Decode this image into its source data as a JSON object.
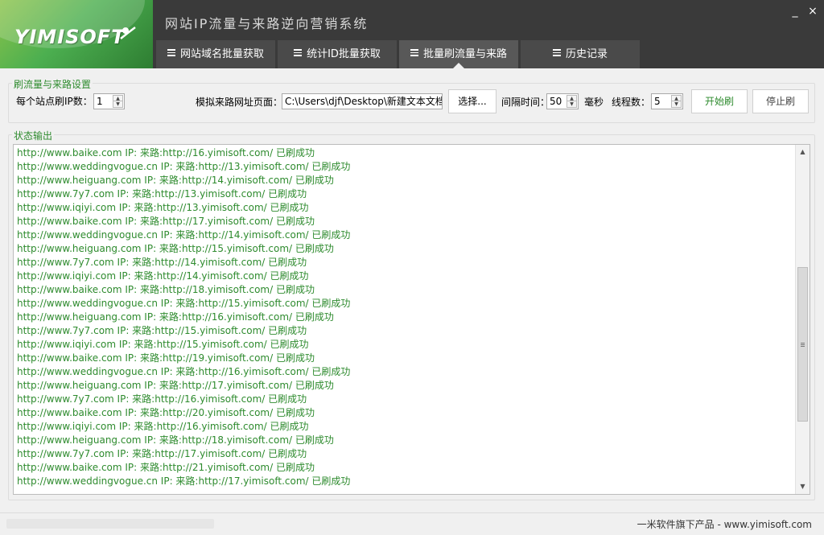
{
  "header": {
    "logo_text": "YIMISOFT",
    "title": "网站IP流量与来路逆向营销系统",
    "minimize_label": "_",
    "close_label": "×"
  },
  "tabs": [
    {
      "label": "网站域名批量获取"
    },
    {
      "label": "统计ID批量获取"
    },
    {
      "label": "批量刷流量与来路"
    },
    {
      "label": "历史记录"
    }
  ],
  "settings": {
    "group_title": "刷流量与来路设置",
    "per_site_label": "每个站点刷IP数：",
    "per_site_value": "1",
    "referer_label": "模拟来路网址页面：",
    "referer_path": "C:\\Users\\djf\\Desktop\\新建文本文档.txt",
    "choose_label": "选择...",
    "interval_label": "间隔时间：",
    "interval_value": "50",
    "interval_unit": "毫秒",
    "threads_label": "线程数：",
    "threads_value": "5",
    "start_label": "开始刷",
    "stop_label": "停止刷"
  },
  "status": {
    "group_title": "状态输出",
    "lines": [
      "http://www.baike.com IP: 来路:http://16.yimisoft.com/ 已刷成功",
      "http://www.weddingvogue.cn IP: 来路:http://13.yimisoft.com/ 已刷成功",
      "http://www.heiguang.com IP: 来路:http://14.yimisoft.com/ 已刷成功",
      "http://www.7y7.com IP: 来路:http://13.yimisoft.com/ 已刷成功",
      "http://www.iqiyi.com IP: 来路:http://13.yimisoft.com/ 已刷成功",
      "http://www.baike.com IP: 来路:http://17.yimisoft.com/ 已刷成功",
      "http://www.weddingvogue.cn IP: 来路:http://14.yimisoft.com/ 已刷成功",
      "http://www.heiguang.com IP: 来路:http://15.yimisoft.com/ 已刷成功",
      "http://www.7y7.com IP: 来路:http://14.yimisoft.com/ 已刷成功",
      "http://www.iqiyi.com IP: 来路:http://14.yimisoft.com/ 已刷成功",
      "http://www.baike.com IP: 来路:http://18.yimisoft.com/ 已刷成功",
      "http://www.weddingvogue.cn IP: 来路:http://15.yimisoft.com/ 已刷成功",
      "http://www.heiguang.com IP: 来路:http://16.yimisoft.com/ 已刷成功",
      "http://www.7y7.com IP: 来路:http://15.yimisoft.com/ 已刷成功",
      "http://www.iqiyi.com IP: 来路:http://15.yimisoft.com/ 已刷成功",
      "http://www.baike.com IP: 来路:http://19.yimisoft.com/ 已刷成功",
      "http://www.weddingvogue.cn IP: 来路:http://16.yimisoft.com/ 已刷成功",
      "http://www.heiguang.com IP: 来路:http://17.yimisoft.com/ 已刷成功",
      "http://www.7y7.com IP: 来路:http://16.yimisoft.com/ 已刷成功",
      "http://www.baike.com IP: 来路:http://20.yimisoft.com/ 已刷成功",
      "http://www.iqiyi.com IP: 来路:http://16.yimisoft.com/ 已刷成功",
      "http://www.heiguang.com IP: 来路:http://18.yimisoft.com/ 已刷成功",
      "http://www.7y7.com IP: 来路:http://17.yimisoft.com/ 已刷成功",
      "http://www.baike.com IP: 来路:http://21.yimisoft.com/ 已刷成功",
      "http://www.weddingvogue.cn IP: 来路:http://17.yimisoft.com/ 已刷成功"
    ]
  },
  "footer": {
    "right_text": "一米软件旗下产品 - www.yimisoft.com"
  },
  "colors": {
    "accent_green": "#2e8b2e",
    "header_bg": "#3a3a3a",
    "tab_bg": "#4a4a4a",
    "tab_active_bg": "#585858"
  }
}
